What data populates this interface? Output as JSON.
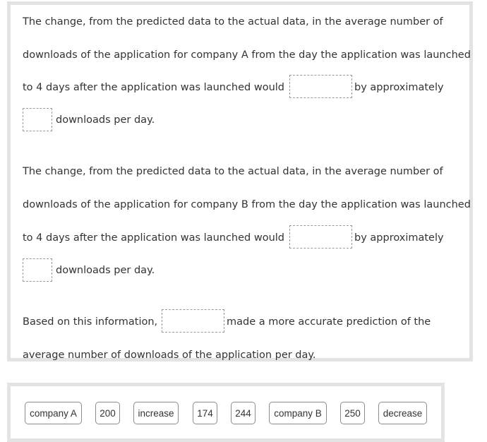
{
  "question": {
    "part_a": {
      "line1": "The change, from the predicted data to the actual data, in the average number of",
      "line2": "downloads of the application for company A from the day the application was launched",
      "line3_before": "to 4 days after the application was launched would",
      "line3_after": "by approximately",
      "line4_after": "downloads per day."
    },
    "part_b": {
      "line1": "The change, from the predicted data to the actual data, in the average number of",
      "line2": "downloads of the application for company B from the day the application was launched",
      "line3_before": "to 4 days after the application was launched would",
      "line3_after": "by approximately",
      "line4_after": "downloads per day."
    },
    "conclusion": {
      "line1_before": "Based on this information,",
      "line1_after": "made a more accurate prediction of the",
      "line2": "average number of downloads of the application per day."
    },
    "blanks": {
      "a_direction": "",
      "a_amount": "",
      "b_direction": "",
      "b_amount": "",
      "conclusion_company": ""
    }
  },
  "answer_bank": {
    "tiles": [
      "company A",
      "200",
      "increase",
      "174",
      "244",
      "company B",
      "250",
      "decrease"
    ]
  }
}
